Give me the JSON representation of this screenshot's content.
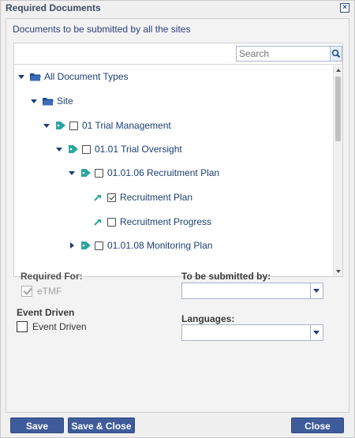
{
  "dialog": {
    "title": "Required Documents",
    "close_icon": "close-x-icon"
  },
  "content": {
    "heading": "Documents to be submitted by all the sites",
    "search": {
      "placeholder": "Search",
      "value": ""
    },
    "tree": [
      {
        "label": "All Document Types",
        "expanded": true,
        "icon": "folder-open-icon",
        "checkbox": false
      },
      {
        "label": "Site",
        "expanded": true,
        "icon": "folder-open-icon",
        "checkbox": false
      },
      {
        "label": "01 Trial Management",
        "expanded": true,
        "icon": "tag-icon",
        "checkbox": true,
        "checked": false
      },
      {
        "label": "01.01 Trial Oversight",
        "expanded": true,
        "icon": "tag-icon",
        "checkbox": true,
        "checked": false
      },
      {
        "label": "01.01.06 Recruitment Plan",
        "expanded": true,
        "icon": "tag-icon",
        "checkbox": true,
        "checked": false
      },
      {
        "label": "Recruitment Plan",
        "icon": "document-link-icon",
        "checkbox": true,
        "checked": true
      },
      {
        "label": "Recruitment Progress",
        "icon": "document-link-icon",
        "checkbox": true,
        "checked": false
      },
      {
        "label": "01.01.08 Monitoring Plan",
        "expanded": false,
        "icon": "tag-icon",
        "checkbox": true,
        "checked": false
      }
    ]
  },
  "form": {
    "required_for_label": "Required For:",
    "etmf_label": "eTMF",
    "etmf_checked": true,
    "event_driven_heading": "Event Driven",
    "event_driven_label": "Event Driven",
    "event_driven_checked": false,
    "submitted_by_label": "To be submitted by:",
    "submitted_by_value": "",
    "languages_label": "Languages:",
    "languages_value": ""
  },
  "footer": {
    "save": "Save",
    "save_close": "Save & Close",
    "close": "Close"
  },
  "colors": {
    "accent": "#3e5c9a",
    "tree_text": "#1b3f73",
    "tag_icon": "#2aa6a0"
  }
}
